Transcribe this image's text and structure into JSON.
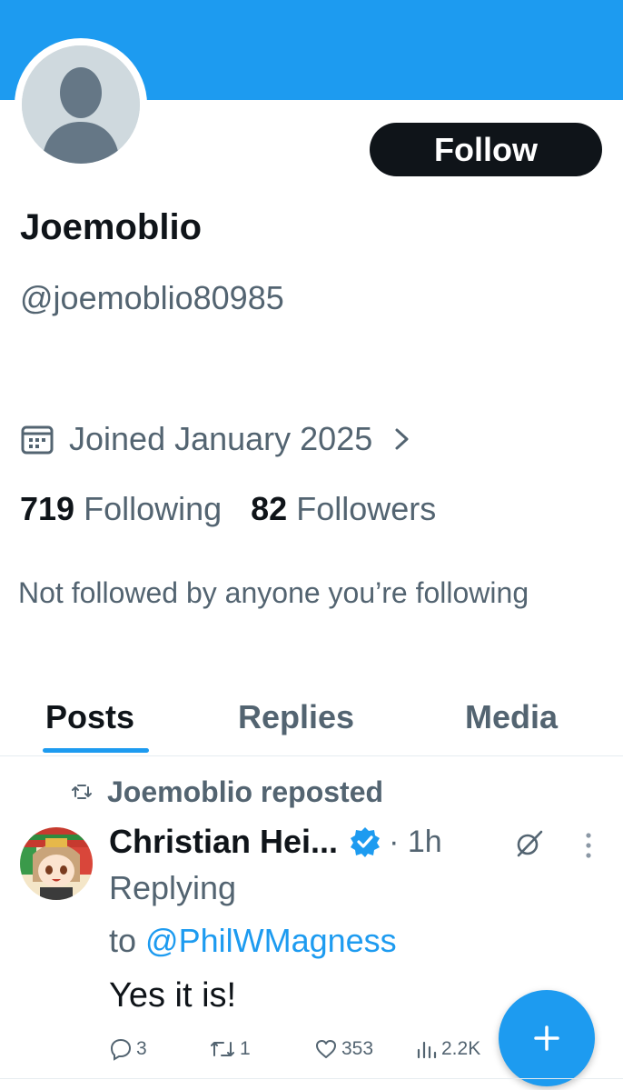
{
  "profile": {
    "display_name": "Joemoblio",
    "handle": "@joemoblio80985",
    "joined": "Joined January 2025",
    "follow_label": "Follow",
    "following_count": "719",
    "following_label": "Following",
    "followers_count": "82",
    "followers_label": "Followers",
    "not_followed_text": "Not followed by anyone you’re following",
    "avatar_icon": "default-avatar-icon",
    "calendar_icon": "calendar-icon"
  },
  "tabs": [
    {
      "label": "Posts",
      "active": true
    },
    {
      "label": "Replies",
      "active": false
    },
    {
      "label": "Media",
      "active": false
    }
  ],
  "post": {
    "repost_label": "Joemoblio reposted",
    "author": "Christian Hei...",
    "time": "· 1h",
    "replying_label": "Replying",
    "replying_to_prefix": "to",
    "replying_to_handle": "@PhilWMagness",
    "text": "Yes it is!",
    "replies": "3",
    "reposts": "1",
    "likes": "353",
    "views": "2.2K"
  },
  "colors": {
    "accent": "#1d9bf0",
    "text_primary": "#0f1419",
    "text_secondary": "#536471",
    "button_dark": "#0f1419"
  },
  "fab": {
    "icon": "plus-icon"
  }
}
